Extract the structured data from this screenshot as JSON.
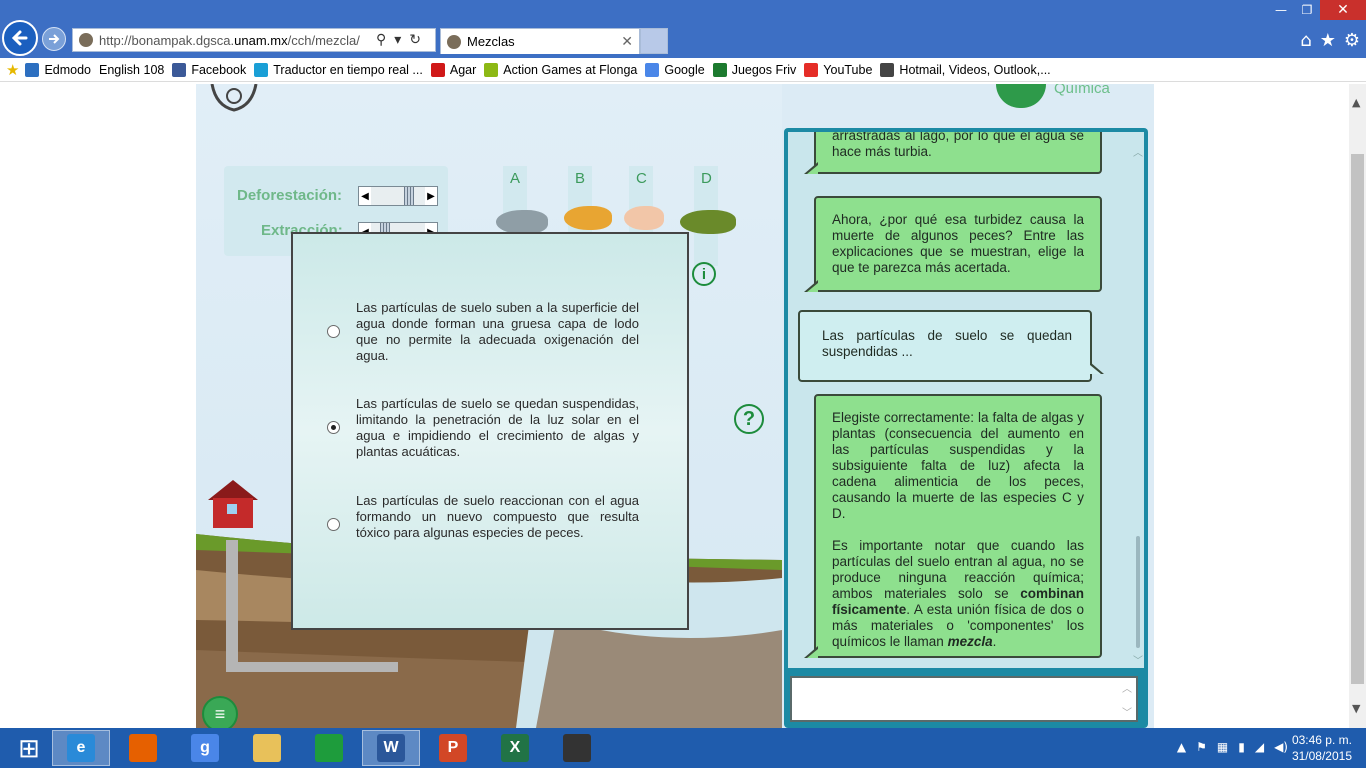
{
  "browser": {
    "url_prefix": "http://bonampak.dgsca.",
    "url_domain": "unam.mx",
    "url_suffix": "/cch/mezcla/",
    "tab_title": "Mezclas",
    "back_icon": "back-arrow-icon",
    "forward_icon": "forward-arrow-icon"
  },
  "favorites": [
    {
      "label": "Edmodo",
      "color": "#2d6fc0"
    },
    {
      "label": "English 108",
      "color": ""
    },
    {
      "label": "Facebook",
      "color": "#3b5998"
    },
    {
      "label": "Traductor en tiempo real ...",
      "color": "#1a9fd6"
    },
    {
      "label": "Agar",
      "color": "#d01818"
    },
    {
      "label": "Action Games at Flonga",
      "color": "#8cb814"
    },
    {
      "label": "Google",
      "color": "#4a86e8"
    },
    {
      "label": "Juegos Friv",
      "color": "#1c7a2e"
    },
    {
      "label": "YouTube",
      "color": "#e52d27"
    },
    {
      "label": "Hotmail, Videos, Outlook,...",
      "color": "#444444"
    }
  ],
  "app": {
    "header_right": "Química",
    "controls": {
      "deforestation_label": "Deforestación:",
      "extraction_label": "Extracción:",
      "deforestation_value": 0.72,
      "extraction_value": 0.2
    },
    "fish_labels": [
      "A",
      "B",
      "C",
      "D"
    ],
    "info_icon": "i",
    "help_icon": "?",
    "menu_icon": "menu-icon"
  },
  "modal": {
    "options": [
      {
        "text": "Las partículas de suelo suben a la superficie del agua donde forman una gruesa capa de lodo que no permite la adecuada oxigenación del agua.",
        "selected": false
      },
      {
        "text": "Las partículas de suelo se quedan suspendidas, limitando la penetración de la luz solar en el agua e impidiendo el crecimiento de algas y plantas acuáticas.",
        "selected": true
      },
      {
        "text": "Las partículas de suelo reaccionan con el agua formando un nuevo compuesto que resulta tóxico para algunas especies de peces.",
        "selected": false
      }
    ]
  },
  "chat": {
    "msg1": "arrastradas al lago, por lo que el agua se hace más turbia.",
    "msg2": "Ahora, ¿por qué esa turbidez causa la muerte de algunos peces? Entre las explicaciones que se muestran, elige la que te parezca más acertada.",
    "msg3": "Las partículas de suelo se quedan suspendidas ...",
    "msg4_p1": "Elegiste correctamente: la falta de algas y plantas (consecuencia del aumento en las partículas suspendidas y la subsiguiente falta de luz) afecta la cadena alimenticia de los peces, causando la muerte de las especies C y D.",
    "msg4_p2_a": "Es importante notar que cuando las partículas del suelo entran al agua, no se produce ninguna reacción química; ambos materiales solo se ",
    "msg4_p2_b": "combinan físicamente",
    "msg4_p2_c": ". A esta unión física de dos o más materiales o 'componentes' los químicos le llaman ",
    "msg4_p2_d": "mezcla",
    "msg4_p2_e": ".",
    "input_value": ""
  },
  "taskbar": {
    "apps": [
      {
        "name": "start-icon",
        "glyph": "⊞",
        "color": "transparent"
      },
      {
        "name": "internet-explorer-icon",
        "glyph": "e",
        "color": "#2a8ad8"
      },
      {
        "name": "firefox-icon",
        "glyph": "",
        "color": "#e66000"
      },
      {
        "name": "google-icon",
        "glyph": "g",
        "color": "#4a86e8"
      },
      {
        "name": "file-explorer-icon",
        "glyph": "",
        "color": "#e8c15a"
      },
      {
        "name": "store-icon",
        "glyph": "",
        "color": "#1e9c3c"
      },
      {
        "name": "word-icon",
        "glyph": "W",
        "color": "#2b579a"
      },
      {
        "name": "powerpoint-icon",
        "glyph": "P",
        "color": "#d24726"
      },
      {
        "name": "excel-icon",
        "glyph": "X",
        "color": "#217346"
      },
      {
        "name": "puzzle-app-icon",
        "glyph": "",
        "color": "#333333"
      }
    ],
    "time": "03:46 p. m.",
    "date": "31/08/2015"
  }
}
